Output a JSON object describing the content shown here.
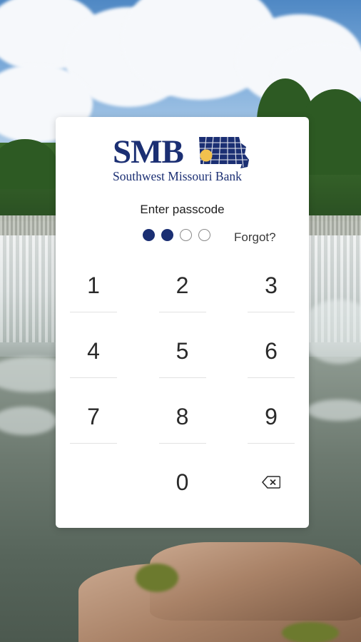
{
  "brand": {
    "mark": "SMB",
    "name": "Southwest Missouri Bank",
    "primary_color": "#1b2f73",
    "accent_color": "#f2c14e"
  },
  "passcode": {
    "prompt": "Enter passcode",
    "length": 4,
    "entered": 2,
    "forgot_label": "Forgot?"
  },
  "keypad": {
    "keys": [
      [
        "1",
        "2",
        "3"
      ],
      [
        "4",
        "5",
        "6"
      ],
      [
        "7",
        "8",
        "9"
      ],
      [
        "",
        "0",
        "backspace-icon"
      ]
    ]
  }
}
